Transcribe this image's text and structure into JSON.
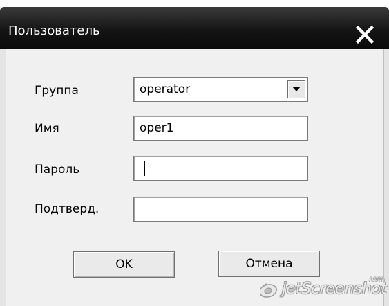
{
  "window": {
    "title": "Пользователь",
    "close_icon": "close-x-icon"
  },
  "form": {
    "group_label": "Группа",
    "group_value": "operator",
    "group_dropdown_icon": "triangle-down-icon",
    "name_label": "Имя",
    "name_value": "oper1",
    "password_label": "Пароль",
    "password_value": "",
    "confirm_label": "Подтверд.",
    "confirm_value": ""
  },
  "buttons": {
    "ok_label": "OK",
    "cancel_label": "Отмена"
  },
  "watermark": {
    "text": "jetScreenshot",
    "suffix": ".com",
    "icon": "jetscreenshot-logo-icon"
  },
  "colors": {
    "titlebar": "#111111",
    "dialog_background": "#f0f0f0"
  }
}
